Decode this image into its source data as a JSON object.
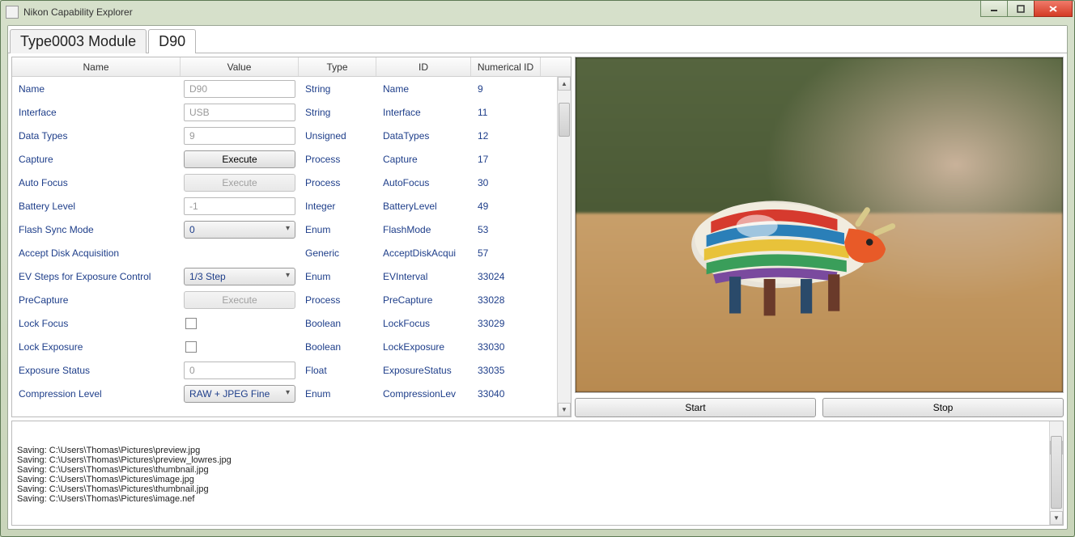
{
  "window": {
    "title": "Nikon Capability Explorer"
  },
  "tabs": [
    {
      "label": "Type0003 Module",
      "active": false
    },
    {
      "label": "D90",
      "active": true
    }
  ],
  "columns": {
    "name": "Name",
    "value": "Value",
    "type": "Type",
    "id": "ID",
    "numerical_id": "Numerical ID"
  },
  "rows": [
    {
      "name": "Name",
      "value_widget": "input_ro",
      "value": "D90",
      "type": "String",
      "id": "Name",
      "num": "9"
    },
    {
      "name": "Interface",
      "value_widget": "input_ro",
      "value": "USB",
      "type": "String",
      "id": "Interface",
      "num": "11"
    },
    {
      "name": "Data Types",
      "value_widget": "input_ro",
      "value": "9",
      "type": "Unsigned",
      "id": "DataTypes",
      "num": "12"
    },
    {
      "name": "Capture",
      "value_widget": "button",
      "value": "Execute",
      "type": "Process",
      "id": "Capture",
      "num": "17"
    },
    {
      "name": "Auto Focus",
      "value_widget": "button_disabled",
      "value": "Execute",
      "type": "Process",
      "id": "AutoFocus",
      "num": "30"
    },
    {
      "name": "Battery Level",
      "value_widget": "input_ro",
      "value": "-1",
      "type": "Integer",
      "id": "BatteryLevel",
      "num": "49"
    },
    {
      "name": "Flash Sync Mode",
      "value_widget": "select",
      "value": "0",
      "type": "Enum",
      "id": "FlashMode",
      "num": "53"
    },
    {
      "name": "Accept Disk Acquisition",
      "value_widget": "none",
      "value": "",
      "type": "Generic",
      "id": "AcceptDiskAcqui",
      "num": "57"
    },
    {
      "name": "EV Steps for Exposure Control",
      "value_widget": "select",
      "value": "1/3 Step",
      "type": "Enum",
      "id": "EVInterval",
      "num": "33024"
    },
    {
      "name": "PreCapture",
      "value_widget": "button_disabled",
      "value": "Execute",
      "type": "Process",
      "id": "PreCapture",
      "num": "33028"
    },
    {
      "name": "Lock Focus",
      "value_widget": "checkbox",
      "value": "",
      "type": "Boolean",
      "id": "LockFocus",
      "num": "33029"
    },
    {
      "name": "Lock Exposure",
      "value_widget": "checkbox",
      "value": "",
      "type": "Boolean",
      "id": "LockExposure",
      "num": "33030"
    },
    {
      "name": "Exposure Status",
      "value_widget": "input_ro",
      "value": "0",
      "type": "Float",
      "id": "ExposureStatus",
      "num": "33035"
    },
    {
      "name": "Compression Level",
      "value_widget": "select",
      "value": "RAW + JPEG Fine",
      "type": "Enum",
      "id": "CompressionLev",
      "num": "33040"
    }
  ],
  "buttons": {
    "start": "Start",
    "stop": "Stop"
  },
  "log_lines": [
    "Saving: C:\\Users\\Thomas\\Pictures\\preview.jpg",
    "Saving: C:\\Users\\Thomas\\Pictures\\preview_lowres.jpg",
    "Saving: C:\\Users\\Thomas\\Pictures\\thumbnail.jpg",
    "Saving: C:\\Users\\Thomas\\Pictures\\image.jpg",
    "Saving: C:\\Users\\Thomas\\Pictures\\thumbnail.jpg",
    "Saving: C:\\Users\\Thomas\\Pictures\\image.nef"
  ]
}
